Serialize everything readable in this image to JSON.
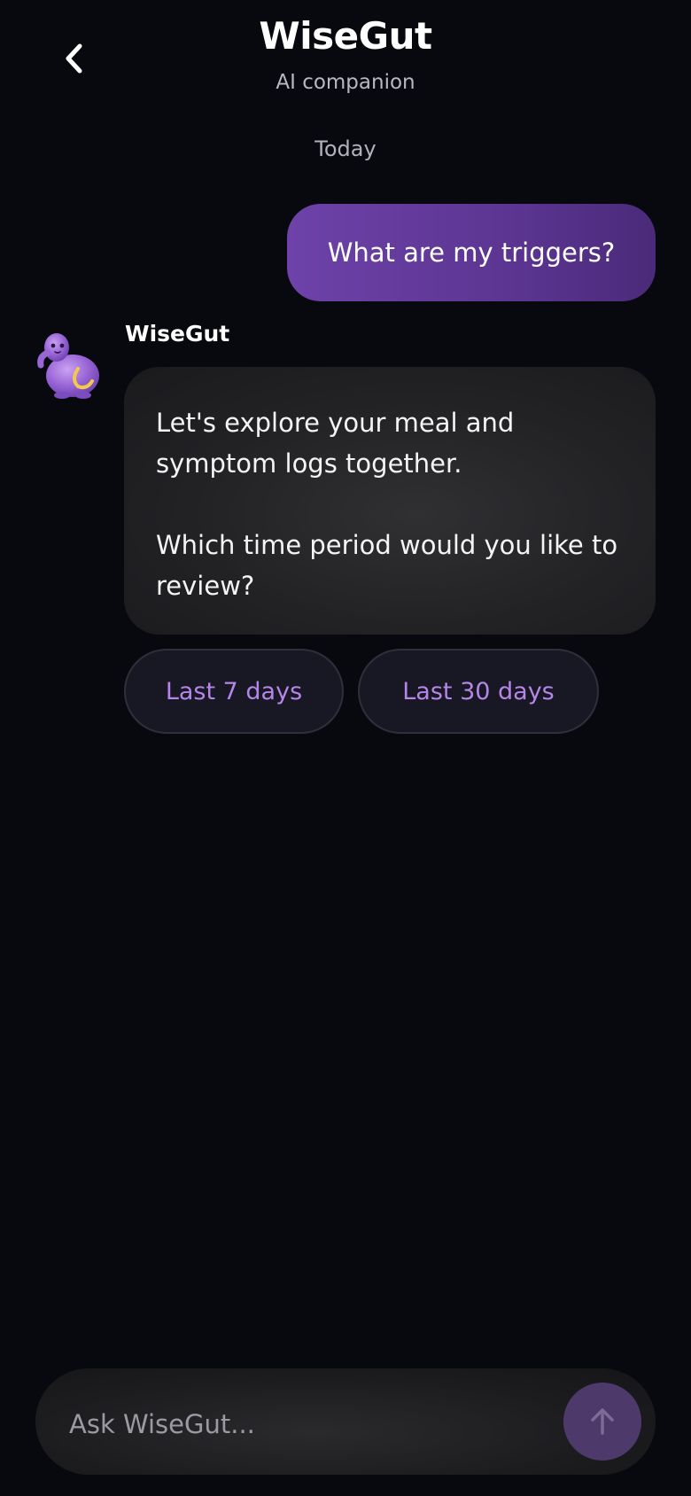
{
  "header": {
    "title": "WiseGut",
    "subtitle": "AI companion",
    "back_icon": "chevron-left-icon"
  },
  "conversation": {
    "date_separator": "Today",
    "user_message": "What are my triggers?",
    "bot": {
      "name": "WiseGut",
      "avatar_icon": "wisegut-mascot-icon",
      "message_paragraphs": [
        "Let's explore your meal and symptom logs together.",
        "Which time period would you like to review?"
      ]
    },
    "quick_replies": [
      "Last 7 days",
      "Last 30 days"
    ]
  },
  "composer": {
    "placeholder": "Ask WiseGut...",
    "send_icon": "arrow-up-icon"
  },
  "colors": {
    "background": "#08090e",
    "user_bubble": "#6e42a9",
    "bot_bubble": "#232326",
    "quick_reply_text": "#b685e8",
    "send_button": "#4d3a6a"
  }
}
